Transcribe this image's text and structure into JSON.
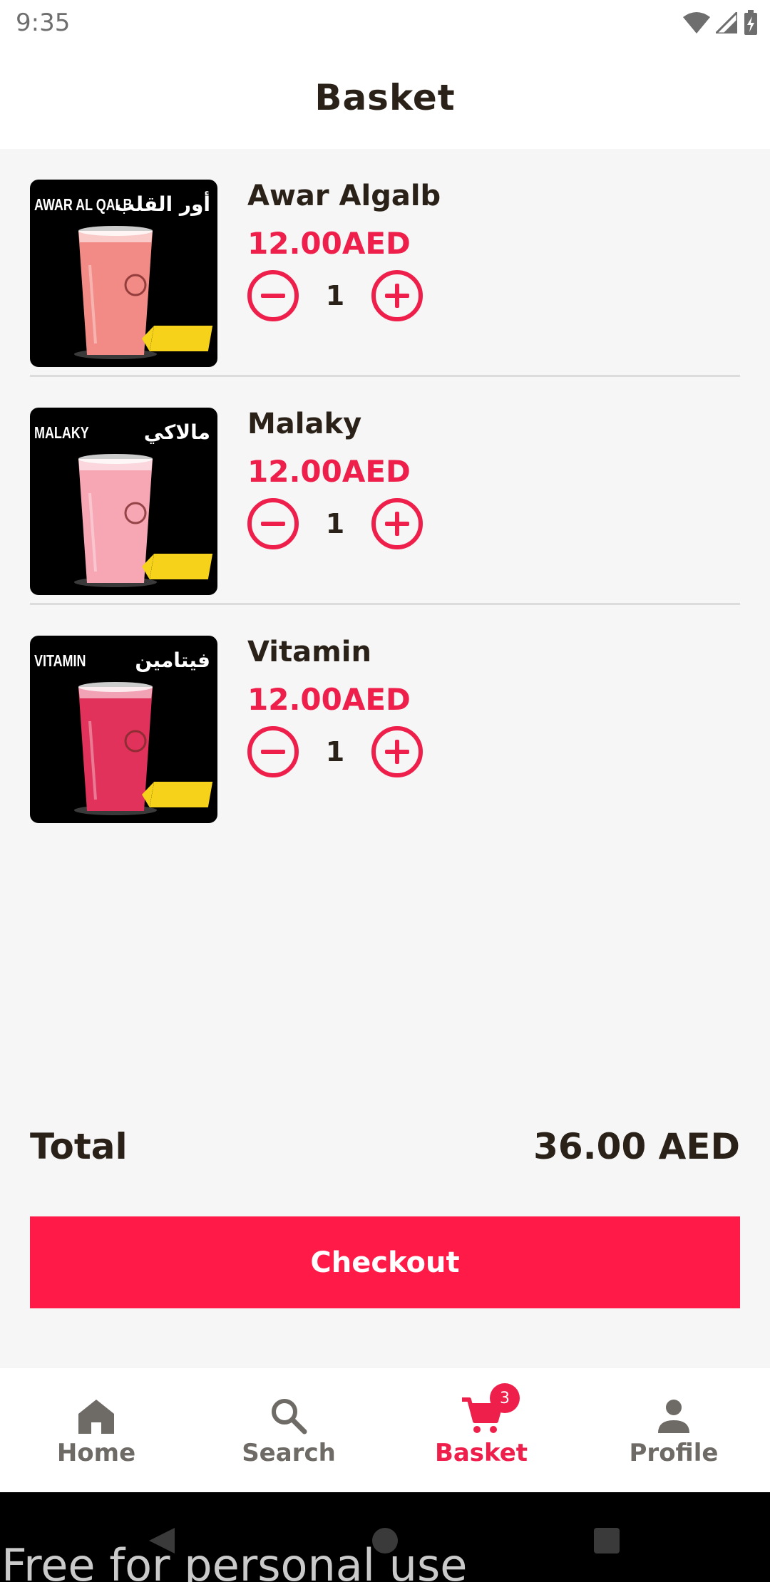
{
  "status_bar": {
    "time": "9:35"
  },
  "app_bar": {
    "title": "Basket"
  },
  "basket": {
    "items": [
      {
        "name": "Awar Algalb",
        "price": "12.00AED",
        "quantity": "1",
        "thumb_en": "AWAR AL QALB",
        "thumb_ar": "أور القلب",
        "cup_color": "#f28b86"
      },
      {
        "name": "Malaky",
        "price": "12.00AED",
        "quantity": "1",
        "thumb_en": "MALAKY",
        "thumb_ar": "مالاكي",
        "cup_color": "#f7a6b4"
      },
      {
        "name": "Vitamin",
        "price": "12.00AED",
        "quantity": "1",
        "thumb_en": "VITAMIN",
        "thumb_ar": "فيتامين",
        "cup_color": "#e0325a"
      }
    ]
  },
  "summary": {
    "total_label": "Total",
    "total_value": "36.00 AED"
  },
  "checkout": {
    "label": "Checkout"
  },
  "bottom_nav": {
    "items": [
      {
        "label": "Home",
        "icon": "home-icon",
        "active": false
      },
      {
        "label": "Search",
        "icon": "search-icon",
        "active": false
      },
      {
        "label": "Basket",
        "icon": "cart-icon",
        "active": true,
        "badge": "3"
      },
      {
        "label": "Profile",
        "icon": "person-icon",
        "active": false
      }
    ]
  },
  "watermark": "Free for personal use",
  "colors": {
    "accent": "#ee1f4a",
    "button": "#ff1a47",
    "text": "#2a2118",
    "nav_inactive": "#6e6a66"
  }
}
